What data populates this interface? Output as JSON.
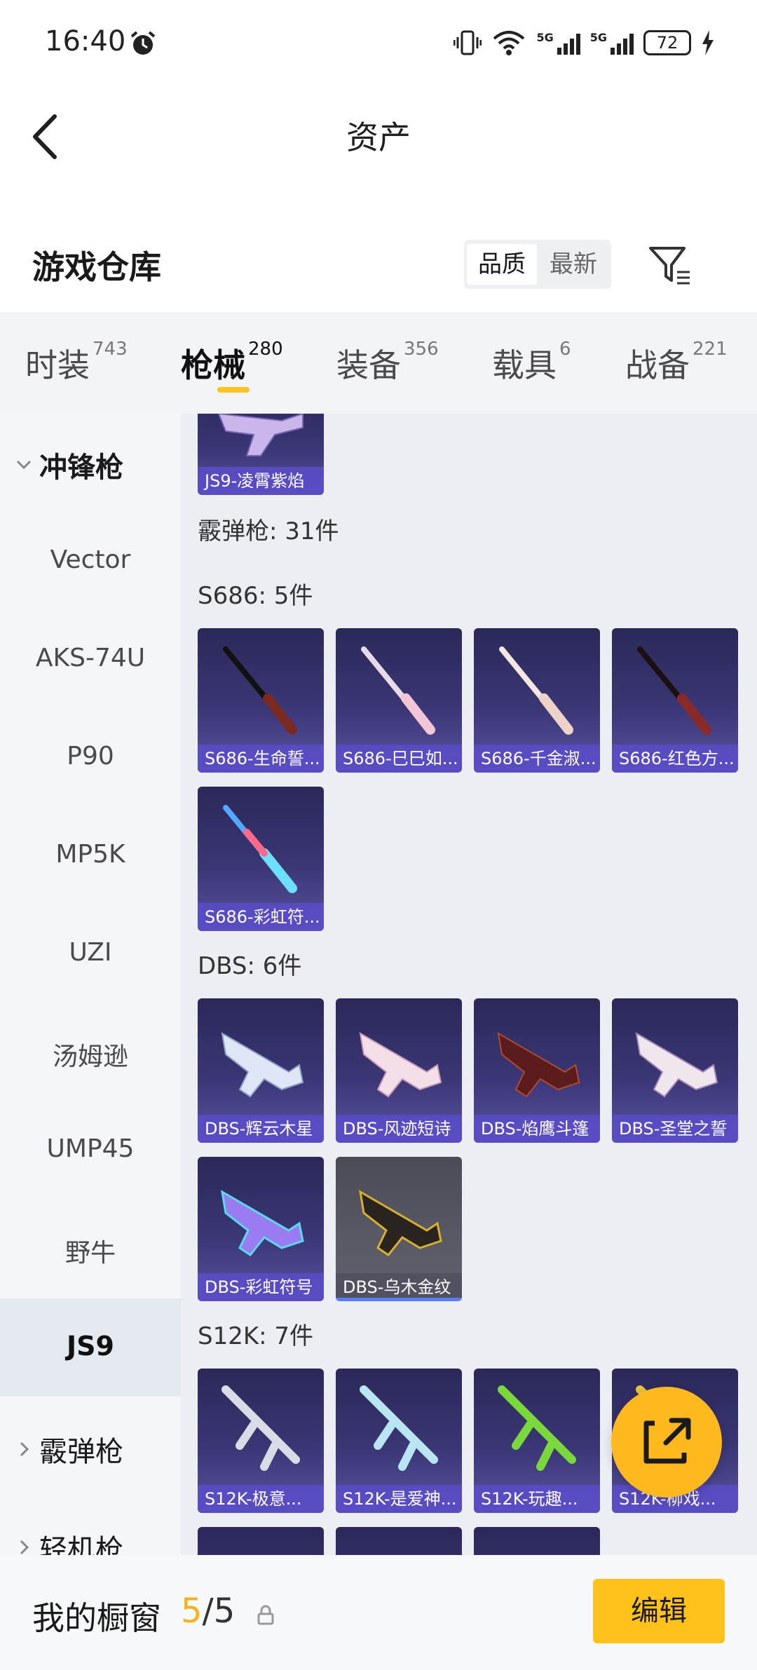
{
  "status_bar": {
    "time": "16:40",
    "net_label_1": "5G",
    "net_label_2": "5G",
    "battery": "72"
  },
  "header": {
    "title": "资产",
    "back_icon": "back-arrow-icon"
  },
  "warehouse": {
    "title": "游戏仓库",
    "sort_options": [
      "品质",
      "最新"
    ],
    "sort_selected": "品质",
    "filter_icon": "filter-icon"
  },
  "tabs": [
    {
      "label": "时装",
      "count": "743"
    },
    {
      "label": "枪械",
      "count": "280"
    },
    {
      "label": "装备",
      "count": "356"
    },
    {
      "label": "载具",
      "count": "6"
    },
    {
      "label": "战备",
      "count": "221"
    }
  ],
  "active_tab": "枪械",
  "sidebar": {
    "group_open": "冲锋枪",
    "items": [
      "Vector",
      "AKS-74U",
      "P90",
      "MP5K",
      "UZI",
      "汤姆逊",
      "UMP45",
      "野牛",
      "JS9"
    ],
    "selected": "JS9",
    "groups_collapsed": [
      "霰弹枪",
      "轻机枪"
    ]
  },
  "content": {
    "top_card": "JS9-凌霄紫焰",
    "category_total": "霰弹枪: 31件",
    "sections": [
      {
        "title": "S686: 5件",
        "items": [
          "S686-生命誓...",
          "S686-巳巳如...",
          "S686-千金淑...",
          "S686-红色方...",
          "S686-彩虹符..."
        ]
      },
      {
        "title": "DBS: 6件",
        "items": [
          "DBS-辉云木星",
          "DBS-风迹短诗",
          "DBS-焰鹰斗篷",
          "DBS-圣堂之誓",
          "DBS-彩虹符号",
          "DBS-乌木金纹"
        ]
      },
      {
        "title": "S12K: 7件",
        "items": [
          "S12K-极意...",
          "S12K-是爱神...",
          "S12K-玩趣...",
          "S12K-柳戏..."
        ]
      }
    ]
  },
  "fab_icon": "share-external-icon",
  "bottom_bar": {
    "showcase_label": "我的橱窗",
    "showcase_current": "5",
    "showcase_separator": "/",
    "showcase_total": "5",
    "lock_icon": "lock-icon",
    "edit_label": "编辑"
  },
  "colors": {
    "accent": "#ffc21a",
    "card_purple": "#3b3675",
    "label_purple": "#5a4cc8"
  }
}
